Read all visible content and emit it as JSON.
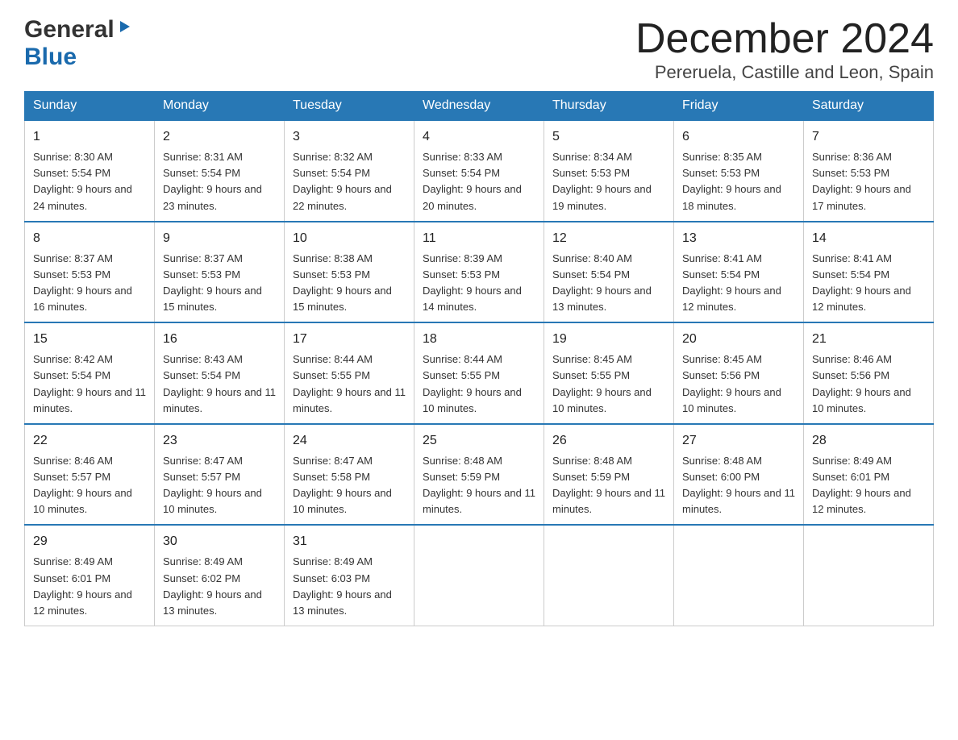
{
  "header": {
    "logo_general": "General",
    "logo_blue": "Blue",
    "month_title": "December 2024",
    "subtitle": "Pereruela, Castille and Leon, Spain"
  },
  "days_of_week": [
    "Sunday",
    "Monday",
    "Tuesday",
    "Wednesday",
    "Thursday",
    "Friday",
    "Saturday"
  ],
  "weeks": [
    [
      {
        "day": "1",
        "sunrise": "8:30 AM",
        "sunset": "5:54 PM",
        "daylight": "9 hours and 24 minutes."
      },
      {
        "day": "2",
        "sunrise": "8:31 AM",
        "sunset": "5:54 PM",
        "daylight": "9 hours and 23 minutes."
      },
      {
        "day": "3",
        "sunrise": "8:32 AM",
        "sunset": "5:54 PM",
        "daylight": "9 hours and 22 minutes."
      },
      {
        "day": "4",
        "sunrise": "8:33 AM",
        "sunset": "5:54 PM",
        "daylight": "9 hours and 20 minutes."
      },
      {
        "day": "5",
        "sunrise": "8:34 AM",
        "sunset": "5:53 PM",
        "daylight": "9 hours and 19 minutes."
      },
      {
        "day": "6",
        "sunrise": "8:35 AM",
        "sunset": "5:53 PM",
        "daylight": "9 hours and 18 minutes."
      },
      {
        "day": "7",
        "sunrise": "8:36 AM",
        "sunset": "5:53 PM",
        "daylight": "9 hours and 17 minutes."
      }
    ],
    [
      {
        "day": "8",
        "sunrise": "8:37 AM",
        "sunset": "5:53 PM",
        "daylight": "9 hours and 16 minutes."
      },
      {
        "day": "9",
        "sunrise": "8:37 AM",
        "sunset": "5:53 PM",
        "daylight": "9 hours and 15 minutes."
      },
      {
        "day": "10",
        "sunrise": "8:38 AM",
        "sunset": "5:53 PM",
        "daylight": "9 hours and 15 minutes."
      },
      {
        "day": "11",
        "sunrise": "8:39 AM",
        "sunset": "5:53 PM",
        "daylight": "9 hours and 14 minutes."
      },
      {
        "day": "12",
        "sunrise": "8:40 AM",
        "sunset": "5:54 PM",
        "daylight": "9 hours and 13 minutes."
      },
      {
        "day": "13",
        "sunrise": "8:41 AM",
        "sunset": "5:54 PM",
        "daylight": "9 hours and 12 minutes."
      },
      {
        "day": "14",
        "sunrise": "8:41 AM",
        "sunset": "5:54 PM",
        "daylight": "9 hours and 12 minutes."
      }
    ],
    [
      {
        "day": "15",
        "sunrise": "8:42 AM",
        "sunset": "5:54 PM",
        "daylight": "9 hours and 11 minutes."
      },
      {
        "day": "16",
        "sunrise": "8:43 AM",
        "sunset": "5:54 PM",
        "daylight": "9 hours and 11 minutes."
      },
      {
        "day": "17",
        "sunrise": "8:44 AM",
        "sunset": "5:55 PM",
        "daylight": "9 hours and 11 minutes."
      },
      {
        "day": "18",
        "sunrise": "8:44 AM",
        "sunset": "5:55 PM",
        "daylight": "9 hours and 10 minutes."
      },
      {
        "day": "19",
        "sunrise": "8:45 AM",
        "sunset": "5:55 PM",
        "daylight": "9 hours and 10 minutes."
      },
      {
        "day": "20",
        "sunrise": "8:45 AM",
        "sunset": "5:56 PM",
        "daylight": "9 hours and 10 minutes."
      },
      {
        "day": "21",
        "sunrise": "8:46 AM",
        "sunset": "5:56 PM",
        "daylight": "9 hours and 10 minutes."
      }
    ],
    [
      {
        "day": "22",
        "sunrise": "8:46 AM",
        "sunset": "5:57 PM",
        "daylight": "9 hours and 10 minutes."
      },
      {
        "day": "23",
        "sunrise": "8:47 AM",
        "sunset": "5:57 PM",
        "daylight": "9 hours and 10 minutes."
      },
      {
        "day": "24",
        "sunrise": "8:47 AM",
        "sunset": "5:58 PM",
        "daylight": "9 hours and 10 minutes."
      },
      {
        "day": "25",
        "sunrise": "8:48 AM",
        "sunset": "5:59 PM",
        "daylight": "9 hours and 11 minutes."
      },
      {
        "day": "26",
        "sunrise": "8:48 AM",
        "sunset": "5:59 PM",
        "daylight": "9 hours and 11 minutes."
      },
      {
        "day": "27",
        "sunrise": "8:48 AM",
        "sunset": "6:00 PM",
        "daylight": "9 hours and 11 minutes."
      },
      {
        "day": "28",
        "sunrise": "8:49 AM",
        "sunset": "6:01 PM",
        "daylight": "9 hours and 12 minutes."
      }
    ],
    [
      {
        "day": "29",
        "sunrise": "8:49 AM",
        "sunset": "6:01 PM",
        "daylight": "9 hours and 12 minutes."
      },
      {
        "day": "30",
        "sunrise": "8:49 AM",
        "sunset": "6:02 PM",
        "daylight": "9 hours and 13 minutes."
      },
      {
        "day": "31",
        "sunrise": "8:49 AM",
        "sunset": "6:03 PM",
        "daylight": "9 hours and 13 minutes."
      },
      null,
      null,
      null,
      null
    ]
  ]
}
